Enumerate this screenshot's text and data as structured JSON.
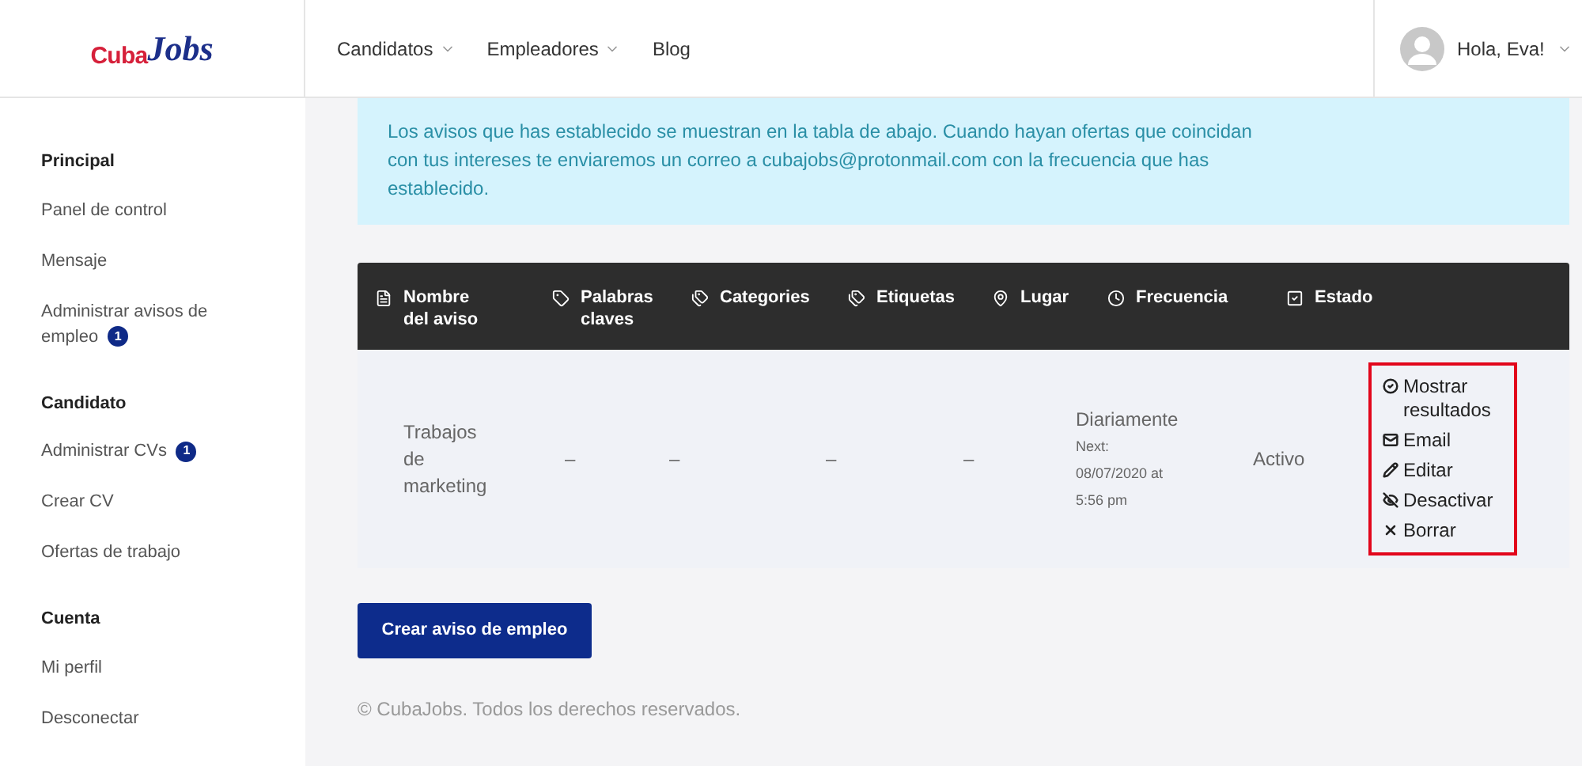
{
  "logo": {
    "part_1": "Cuba",
    "part_2": "Jobs"
  },
  "nav": [
    {
      "label": "Candidatos",
      "has_dropdown": true
    },
    {
      "label": "Empleadores",
      "has_dropdown": true
    },
    {
      "label": "Blog",
      "has_dropdown": false
    }
  ],
  "user_menu": {
    "label": "Hola, Eva!"
  },
  "sidebar": [
    {
      "heading": "Principal",
      "items": [
        {
          "label": "Panel de control"
        },
        {
          "label": "Mensaje"
        },
        {
          "label": "Administrar avisos de empleo",
          "badge": "1"
        }
      ]
    },
    {
      "heading": "Candidato",
      "items": [
        {
          "label": "Administrar CVs",
          "badge": "1"
        },
        {
          "label": "Crear CV"
        },
        {
          "label": "Ofertas de trabajo"
        }
      ]
    },
    {
      "heading": "Cuenta",
      "items": [
        {
          "label": "Mi perfil"
        },
        {
          "label": "Desconectar"
        }
      ]
    }
  ],
  "info_message": "Los avisos que has establecido se muestran en la tabla de abajo. Cuando hayan ofertas que coincidan con tus intereses te enviaremos un correo a cubajobs@protonmail.com con la frecuencia que has establecido.",
  "table": {
    "columns": [
      "Nombre del aviso",
      "Palabras claves",
      "Categories",
      "Etiquetas",
      "Lugar",
      "Frecuencia",
      "Estado"
    ],
    "rows": [
      {
        "name": "Trabajos de marketing",
        "keywords": "–",
        "categories": "–",
        "tags": "–",
        "location": "–",
        "frequency": "Diariamente",
        "next_run": "Next: 08/07/2020 at 5:56 pm",
        "status": "Activo",
        "actions": [
          "Mostrar resultados",
          "Email",
          "Editar",
          "Desactivar",
          "Borrar"
        ]
      }
    ]
  },
  "create_button": "Crear aviso de empleo",
  "footer": "© CubaJobs. Todos los derechos reservados."
}
